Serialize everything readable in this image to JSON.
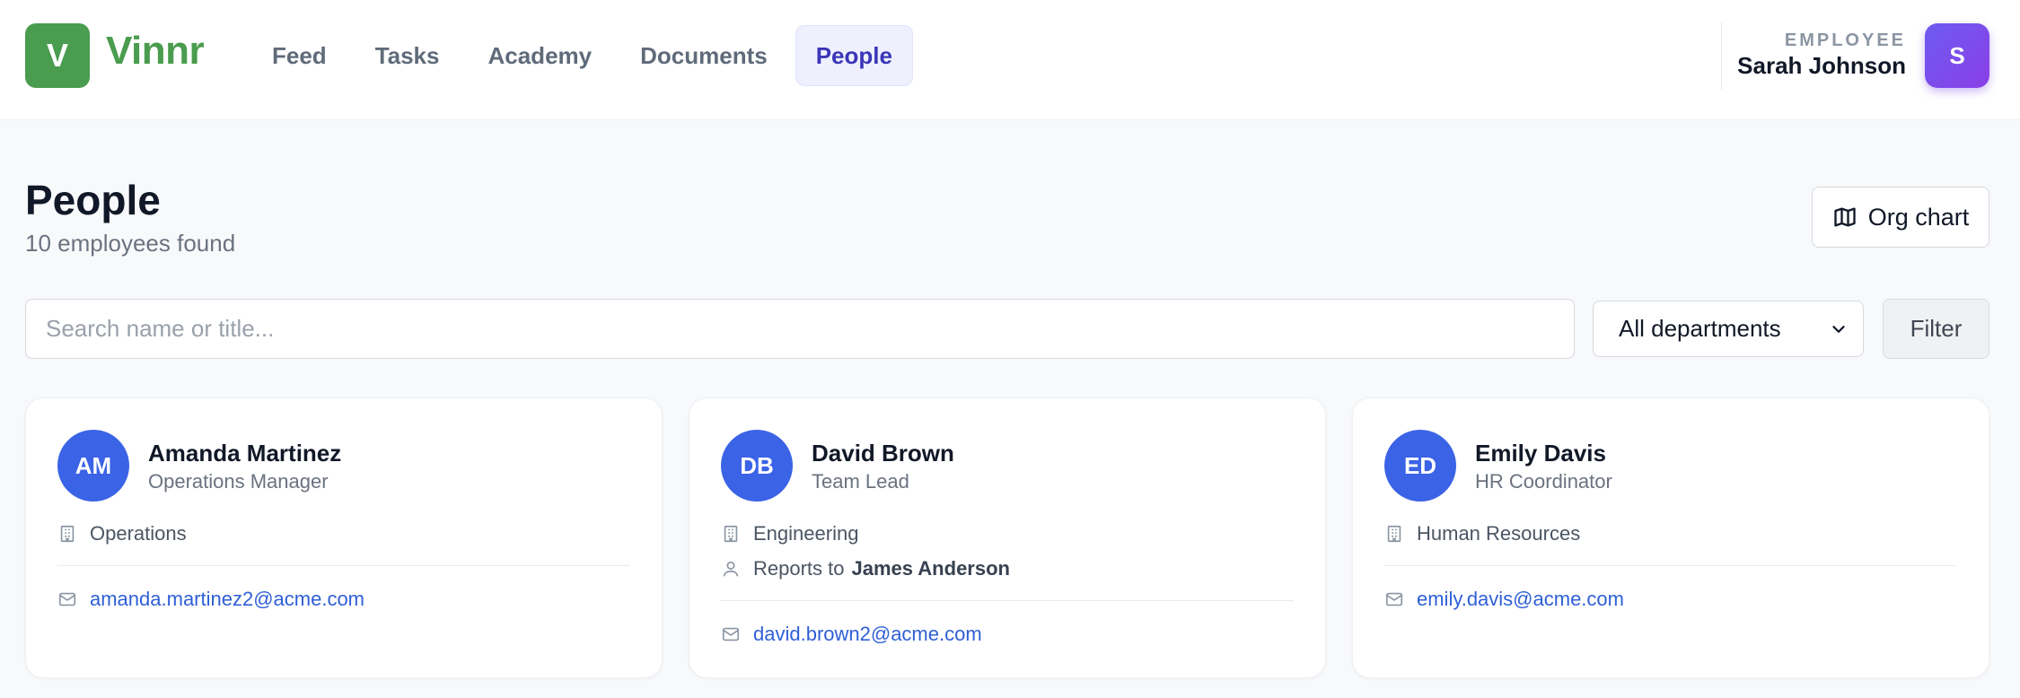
{
  "app": {
    "logo_letter": "V",
    "name": "Vinnr"
  },
  "nav": [
    {
      "label": "Feed",
      "active": false
    },
    {
      "label": "Tasks",
      "active": false
    },
    {
      "label": "Academy",
      "active": false
    },
    {
      "label": "Documents",
      "active": false
    },
    {
      "label": "People",
      "active": true
    }
  ],
  "user": {
    "role": "EMPLOYEE",
    "name": "Sarah Johnson",
    "initial": "S"
  },
  "page": {
    "title": "People",
    "subtitle": "10 employees found",
    "org_chart_label": "Org chart"
  },
  "filters": {
    "search_placeholder": "Search name or title...",
    "department_selected": "All departments",
    "filter_label": "Filter"
  },
  "employees": [
    {
      "initials": "AM",
      "name": "Amanda Martinez",
      "title": "Operations Manager",
      "department": "Operations",
      "reports_prefix": "",
      "reports_to": "",
      "email": "amanda.martinez2@acme.com"
    },
    {
      "initials": "DB",
      "name": "David Brown",
      "title": "Team Lead",
      "department": "Engineering",
      "reports_prefix": "Reports to",
      "reports_to": "James Anderson",
      "email": "david.brown2@acme.com"
    },
    {
      "initials": "ED",
      "name": "Emily Davis",
      "title": "HR Coordinator",
      "department": "Human Resources",
      "reports_prefix": "",
      "reports_to": "",
      "email": "emily.davis@acme.com"
    }
  ],
  "colors": {
    "brand": "#4a9c4e",
    "nav_active": "#3a35b8",
    "avatar": "#3b63e6",
    "link": "#2f5fd6"
  }
}
